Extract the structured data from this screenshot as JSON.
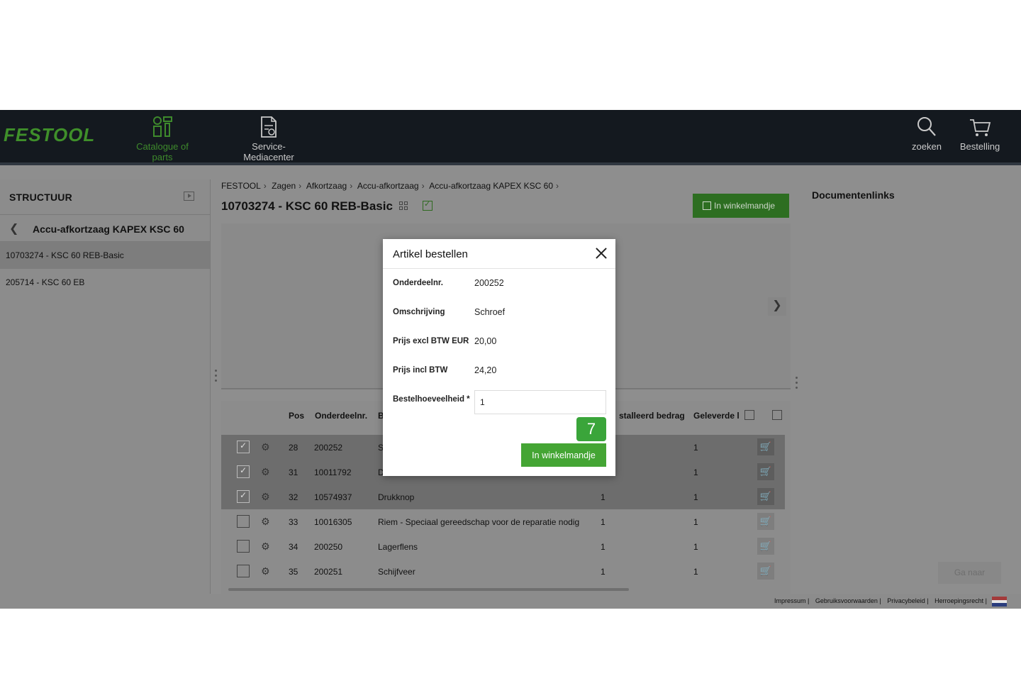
{
  "header": {
    "logo": "FESTOOL",
    "nav": [
      {
        "label": "Catalogue of parts",
        "active": true
      },
      {
        "label": "Service-Mediacenter",
        "active": false
      }
    ],
    "search_label": "zoeken",
    "order_label": "Bestelling"
  },
  "structure": {
    "title": "STRUCTUUR",
    "back_label": "Accu-afkortzaag KAPEX KSC 60",
    "items": [
      {
        "label": "10703274 - KSC 60 REB-Basic",
        "selected": true
      },
      {
        "label": "205714 - KSC 60 EB",
        "selected": false
      }
    ]
  },
  "breadcrumb": [
    "FESTOOL",
    "Zagen",
    "Afkortzaag",
    "Accu-afkortzaag",
    "Accu-afkortzaag KAPEX KSC 60"
  ],
  "product": {
    "title": "10703274 - KSC 60 REB-Basic",
    "cart_button": "In winkelmandje"
  },
  "table": {
    "headers": {
      "pos": "Pos",
      "part_no": "Onderdeelnr.",
      "desc": "B",
      "installed": "stalleerd bedrag",
      "delivered": "Geleverde l"
    },
    "rows": [
      {
        "checked": true,
        "pos": "28",
        "part": "200252",
        "desc": "S",
        "qty": "",
        "delivered": "1"
      },
      {
        "checked": true,
        "pos": "31",
        "part": "10011792",
        "desc": "D",
        "qty": "",
        "delivered": "1"
      },
      {
        "checked": true,
        "pos": "32",
        "part": "10574937",
        "desc": "Drukknop",
        "qty": "1",
        "delivered": "1"
      },
      {
        "checked": false,
        "pos": "33",
        "part": "10016305",
        "desc": "Riem  - Speciaal gereedschap voor de reparatie nodig",
        "qty": "1",
        "delivered": "1"
      },
      {
        "checked": false,
        "pos": "34",
        "part": "200250",
        "desc": "Lagerflens",
        "qty": "1",
        "delivered": "1"
      },
      {
        "checked": false,
        "pos": "35",
        "part": "200251",
        "desc": "Schijfveer",
        "qty": "1",
        "delivered": "1"
      }
    ]
  },
  "documents": {
    "title": "Documentenlinks",
    "goto_button": "Ga naar"
  },
  "footer": {
    "links": [
      "Impressum |",
      "Gebruiksvoorwaarden |",
      "Privacybeleid |",
      "Herroepingsrecht |"
    ]
  },
  "modal": {
    "title": "Artikel bestellen",
    "fields": [
      {
        "label": "Onderdeelnr.",
        "value": "200252"
      },
      {
        "label": "Omschrijving",
        "value": "Schroef"
      },
      {
        "label": "Prijs excl BTW EUR",
        "value": "20,00"
      },
      {
        "label": "Prijs incl BTW",
        "value": "24,20"
      }
    ],
    "quantity_label": "Bestelhoeveelheid *",
    "quantity_value": "1",
    "step_badge": "7",
    "cart_button": "In winkelmandje"
  },
  "colors": {
    "brand_green": "#3f8f2a",
    "button_green": "#44a534",
    "header_bg": "#14191f"
  }
}
